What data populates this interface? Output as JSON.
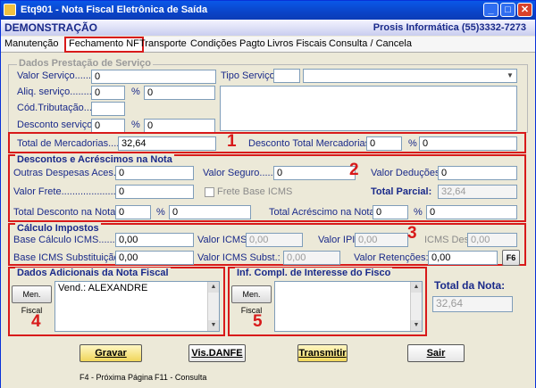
{
  "window": {
    "title": "Etq901 - Nota Fiscal Eletrônica de Saída",
    "btn_min": "_",
    "btn_max": "□",
    "btn_close": "✕",
    "icon": "app-icon"
  },
  "band": {
    "left": "DEMONSTRAÇÃO",
    "right": "Prosis Informática (55)3332-7273"
  },
  "tabs": [
    "Manutenção",
    "Fechamento NF",
    "Transporte",
    "Condições Pagto",
    "Livros Fiscais",
    "Consulta / Cancela"
  ],
  "servico": {
    "section": "Dados Prestação de Serviço",
    "valor_lbl": "Valor Serviço.......:",
    "valor": "0",
    "aliq_lbl": "Aliq. serviço.........:",
    "aliq": "0",
    "pct": "%",
    "aliq2": "0",
    "cod_lbl": "Cód.Tributação...:",
    "cod": "",
    "desc_lbl": "Desconto serviço:",
    "desc": "0",
    "desc2": "0",
    "tipo_lbl": "Tipo Serviço:",
    "tipo": "",
    "tipo_desc": ""
  },
  "mercadorias": {
    "total_lbl": "Total de Mercadorias......:",
    "total": "32,64",
    "desc_lbl": "Desconto Total Mercadorias:",
    "desc": "0",
    "pct": "%",
    "desc2": "0",
    "marker": "1"
  },
  "descontos": {
    "section": "Descontos e Acréscimos na Nota",
    "outras_lbl": "Outras Despesas  Aces.:",
    "outras": "0",
    "seguro_lbl": "Valor  Seguro.......:",
    "seguro": "0",
    "deducoes_lbl": "Valor Deduções:",
    "deducoes": "0",
    "frete_lbl": "Valor  Frete........................:",
    "frete": "0",
    "frete_base_lbl": "Frete Base ICMS",
    "parcial_lbl": "Total  Parcial:",
    "parcial": "32,64",
    "totdesc_lbl": "Total Desconto na Nota.:",
    "totdesc": "0",
    "pct": "%",
    "totdesc2": "0",
    "acres_lbl": "Total Acréscimo na Nota:",
    "acres": "0",
    "acres2": "0",
    "marker": "2"
  },
  "impostos": {
    "section": "Cálculo Impostos",
    "base_lbl": "Base Cálculo ICMS.........:",
    "base": "0,00",
    "icms_lbl": "Valor ICMS:",
    "icms": "0,00",
    "ipi_lbl": "Valor IPI:",
    "ipi": "0,00",
    "icmsdes_lbl": "ICMS Des.:",
    "icmsdes": "0,00",
    "basest_lbl": "Base ICMS Substituição.:",
    "basest": "0,00",
    "icmsst_lbl": "Valor ICMS Subst.:",
    "icmsst": "0,00",
    "ret_lbl": "Valor Retenções:",
    "ret": "0,00",
    "f6": "F6",
    "marker": "3"
  },
  "adicionais": {
    "section": "Dados Adicionais da Nota Fiscal",
    "men_btn": "Men. Fiscal",
    "text": "Vend.: ALEXANDRE",
    "marker": "4"
  },
  "fisco": {
    "section": "Inf. Compl. de Interesse do Fisco",
    "men_btn": "Men. Fiscal",
    "text": "",
    "marker": "5"
  },
  "total_nota": {
    "label": "Total  da Nota:",
    "value": "32,64"
  },
  "buttons": {
    "gravar": "Gravar",
    "danfe": "Vis.DANFE",
    "transmitir": "Transmitir",
    "sair": "Sair"
  },
  "status": {
    "f4": "F4 - Próxima Página",
    "f11": "F11 - Consulta"
  },
  "colors": {
    "accent": "#1a2a8a",
    "highlight": "#d81a1a",
    "title": "#0a58e8"
  }
}
